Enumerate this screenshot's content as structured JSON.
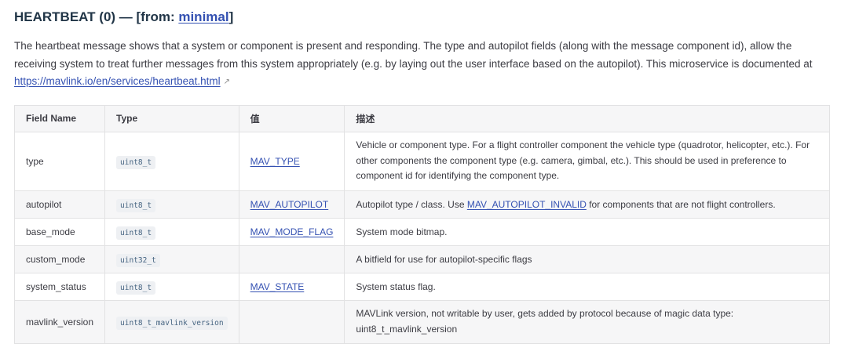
{
  "heading": {
    "prefix": "HEARTBEAT (0) — [from: ",
    "link": "minimal",
    "suffix": "]"
  },
  "description": {
    "text": "The heartbeat message shows that a system or component is present and responding. The type and autopilot fields (along with the message component id), allow the receiving system to treat further messages from this system appropriately (e.g. by laying out the user interface based on the autopilot). This microservice is documented at ",
    "link": "https://mavlink.io/en/services/heartbeat.html",
    "ext_icon": "external-link-icon"
  },
  "table": {
    "headers": [
      "Field Name",
      "Type",
      "值",
      "描述"
    ],
    "rows": [
      {
        "name": "type",
        "type": "uint8_t",
        "value": "MAV_TYPE",
        "desc": "Vehicle or component type. For a flight controller component the vehicle type (quadrotor, helicopter, etc.). For other components the component type (e.g. camera, gimbal, etc.). This should be used in preference to component id for identifying the component type."
      },
      {
        "name": "autopilot",
        "type": "uint8_t",
        "value": "MAV_AUTOPILOT",
        "desc_before": "Autopilot type / class. Use ",
        "desc_link": "MAV_AUTOPILOT_INVALID",
        "desc_after": " for components that are not flight controllers."
      },
      {
        "name": "base_mode",
        "type": "uint8_t",
        "value": "MAV_MODE_FLAG",
        "desc": "System mode bitmap."
      },
      {
        "name": "custom_mode",
        "type": "uint32_t",
        "value": "",
        "desc": "A bitfield for use for autopilot-specific flags"
      },
      {
        "name": "system_status",
        "type": "uint8_t",
        "value": "MAV_STATE",
        "desc": "System status flag."
      },
      {
        "name": "mavlink_version",
        "type": "uint8_t_mavlink_version",
        "value": "",
        "desc": "MAVLink version, not writable by user, gets added by protocol because of magic data type: uint8_t_mavlink_version"
      }
    ]
  }
}
